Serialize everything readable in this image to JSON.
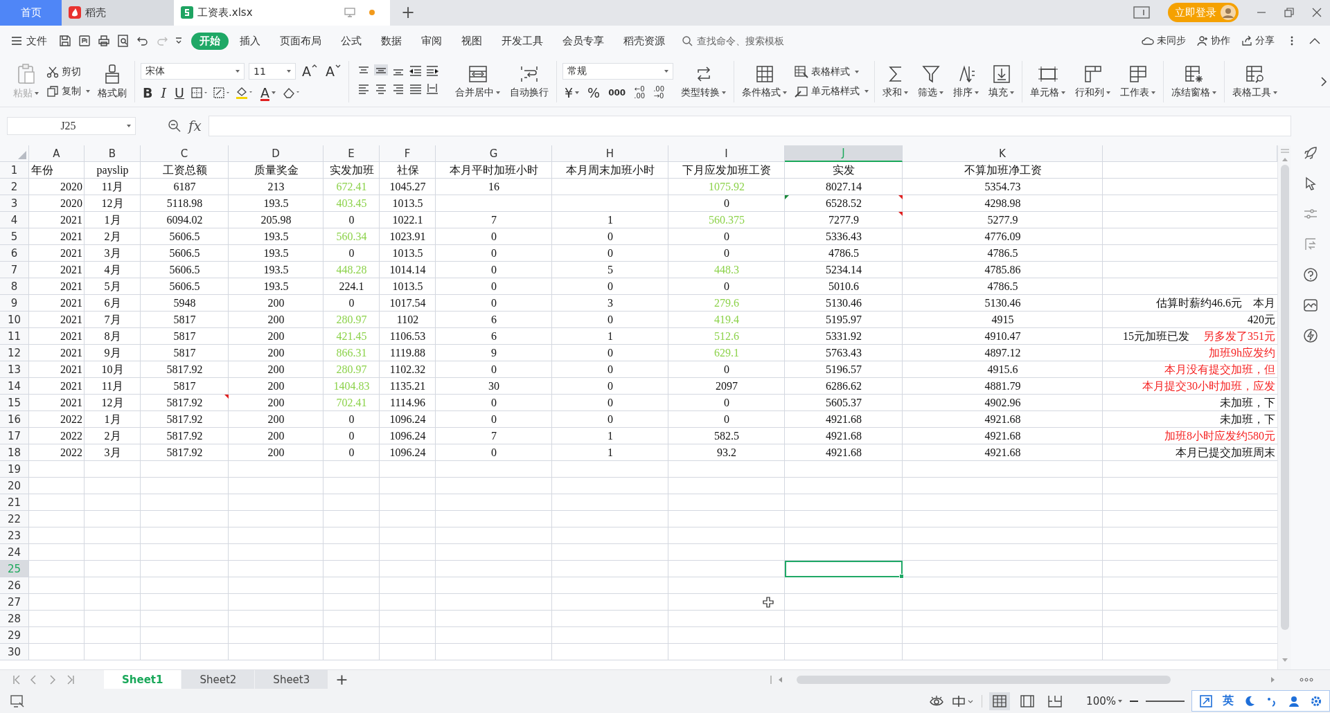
{
  "tabs": [
    {
      "kind": "home",
      "label": "首页",
      "selected": false
    },
    {
      "kind": "docer",
      "label": "稻壳",
      "selected": false
    },
    {
      "kind": "file",
      "label": "工资表.xlsx",
      "selected": true,
      "unsaved": true
    }
  ],
  "new_tab": "+",
  "login_button": "立即登录",
  "menu": {
    "file": "文件",
    "tabs": [
      {
        "label": "开始",
        "selected": true
      },
      {
        "label": "插入",
        "selected": false
      },
      {
        "label": "页面布局",
        "selected": false
      },
      {
        "label": "公式",
        "selected": false
      },
      {
        "label": "数据",
        "selected": false
      },
      {
        "label": "审阅",
        "selected": false
      },
      {
        "label": "视图",
        "selected": false
      },
      {
        "label": "开发工具",
        "selected": false
      },
      {
        "label": "会员专享",
        "selected": false
      },
      {
        "label": "稻壳资源",
        "selected": false
      }
    ],
    "search_placeholder": "查找命令、搜索模板",
    "sync": "未同步",
    "collab": "协作",
    "share": "分享"
  },
  "ribbon": {
    "paste": "粘贴",
    "paste_disabled": true,
    "cut": "剪切",
    "copy": "复制",
    "format_painter": "格式刷",
    "font": "宋体",
    "font_size": "11",
    "grow_font": "A",
    "shrink_font": "A",
    "bold": "B",
    "italic": "I",
    "underline": "U",
    "font_color": "A",
    "merge": "合并居中",
    "wrap": "自动换行",
    "number_format": "常规",
    "currency": "¥",
    "percent": "%",
    "thousands": "000",
    "decimal_increase": [
      "←0",
      ".00"
    ],
    "decimal_decrease": [
      ".00",
      "→0"
    ],
    "type_convert": "类型转换",
    "cond_format": "条件格式",
    "table_style": "表格样式",
    "cell_style": "单元格样式",
    "sum": "求和",
    "filter": "筛选",
    "sort": "排序",
    "fill": "填充",
    "cell": "单元格",
    "row_col": "行和列",
    "sheet": "工作表",
    "freeze": "冻结窗格",
    "table_tools": "表格工具"
  },
  "formula_bar": {
    "name_box": "J25",
    "fx": "fx"
  },
  "sheet": {
    "columns": [
      {
        "label": "A",
        "selected": false
      },
      {
        "label": "B",
        "selected": false
      },
      {
        "label": "C",
        "selected": false
      },
      {
        "label": "D",
        "selected": false
      },
      {
        "label": "E",
        "selected": false
      },
      {
        "label": "F",
        "selected": false
      },
      {
        "label": "G",
        "selected": false
      },
      {
        "label": "H",
        "selected": false
      },
      {
        "label": "I",
        "selected": false
      },
      {
        "label": "J",
        "selected": true
      },
      {
        "label": "K",
        "selected": false
      }
    ],
    "row_headers": [
      {
        "label": "1",
        "selected": false
      },
      {
        "label": "2",
        "selected": false
      },
      {
        "label": "3",
        "selected": false
      },
      {
        "label": "4",
        "selected": false
      },
      {
        "label": "5",
        "selected": false
      },
      {
        "label": "6",
        "selected": false
      },
      {
        "label": "7",
        "selected": false
      },
      {
        "label": "8",
        "selected": false
      },
      {
        "label": "9",
        "selected": false
      },
      {
        "label": "10",
        "selected": false
      },
      {
        "label": "11",
        "selected": false
      },
      {
        "label": "12",
        "selected": false
      },
      {
        "label": "13",
        "selected": false
      },
      {
        "label": "14",
        "selected": false
      },
      {
        "label": "15",
        "selected": false
      },
      {
        "label": "16",
        "selected": false
      },
      {
        "label": "17",
        "selected": false
      },
      {
        "label": "18",
        "selected": false
      },
      {
        "label": "19",
        "selected": false
      },
      {
        "label": "20",
        "selected": false
      },
      {
        "label": "21",
        "selected": false
      },
      {
        "label": "22",
        "selected": false
      },
      {
        "label": "23",
        "selected": false
      },
      {
        "label": "24",
        "selected": false
      },
      {
        "label": "25",
        "selected": true
      },
      {
        "label": "26",
        "selected": false
      },
      {
        "label": "27",
        "selected": false
      },
      {
        "label": "28",
        "selected": false
      },
      {
        "label": "29",
        "selected": false
      },
      {
        "label": "30",
        "selected": false
      }
    ],
    "rows": [
      {
        "cells": [
          "年份",
          "payslip",
          "工资总额",
          "质量奖金",
          "实发加班",
          "社保",
          "本月平时加班小时",
          "本月周末加班小时",
          "下月应发加班工资",
          "实发",
          "不算加班净工资"
        ],
        "e_green": false,
        "i_green": false,
        "c_comment": false,
        "j_error": false,
        "j_comment": false
      },
      {
        "cells": [
          "2020",
          "11月",
          "6187",
          "213",
          "672.41",
          "1045.27",
          "16",
          null,
          "1075.92",
          "8027.14",
          "5354.73"
        ],
        "e_green": true,
        "i_green": true,
        "c_comment": false,
        "j_error": false,
        "j_comment": false
      },
      {
        "cells": [
          "2020",
          "12月",
          "5118.98",
          "193.5",
          "403.45",
          "1013.5",
          null,
          null,
          "0",
          "6528.52",
          "4298.98"
        ],
        "e_green": true,
        "i_green": false,
        "c_comment": false,
        "j_error": true,
        "j_comment": true
      },
      {
        "cells": [
          "2021",
          "1月",
          "6094.02",
          "205.98",
          "0",
          "1022.1",
          "7",
          "1",
          "560.375",
          "7277.9",
          "5277.9"
        ],
        "e_green": false,
        "i_green": true,
        "c_comment": false,
        "j_error": false,
        "j_comment": true
      },
      {
        "cells": [
          "2021",
          "2月",
          "5606.5",
          "193.5",
          "560.34",
          "1023.91",
          "0",
          "0",
          "0",
          "5336.43",
          "4776.09"
        ],
        "e_green": true,
        "i_green": false,
        "c_comment": false,
        "j_error": false,
        "j_comment": false
      },
      {
        "cells": [
          "2021",
          "3月",
          "5606.5",
          "193.5",
          "0",
          "1013.5",
          "0",
          "0",
          "0",
          "4786.5",
          "4786.5"
        ],
        "e_green": false,
        "i_green": false,
        "c_comment": false,
        "j_error": false,
        "j_comment": false
      },
      {
        "cells": [
          "2021",
          "4月",
          "5606.5",
          "193.5",
          "448.28",
          "1014.14",
          "0",
          "5",
          "448.3",
          "5234.14",
          "4785.86"
        ],
        "e_green": true,
        "i_green": true,
        "c_comment": false,
        "j_error": false,
        "j_comment": false
      },
      {
        "cells": [
          "2021",
          "5月",
          "5606.5",
          "193.5",
          "224.1",
          "1013.5",
          "0",
          "0",
          "0",
          "5010.6",
          "4786.5"
        ],
        "e_green": false,
        "i_green": false,
        "c_comment": false,
        "j_error": false,
        "j_comment": false
      },
      {
        "cells": [
          "2021",
          "6月",
          "5948",
          "200",
          "0",
          "1017.54",
          "0",
          "3",
          "279.6",
          "5130.46",
          "5130.46"
        ],
        "e_green": false,
        "i_green": true,
        "c_comment": false,
        "j_error": false,
        "j_comment": false,
        "note": [
          {
            "text": "估算时薪约46.6元　本月",
            "kind": "plain"
          }
        ]
      },
      {
        "cells": [
          "2021",
          "7月",
          "5817",
          "200",
          "280.97",
          "1102",
          "6",
          "0",
          "419.4",
          "5195.97",
          "4915"
        ],
        "e_green": true,
        "i_green": true,
        "c_comment": false,
        "j_error": false,
        "j_comment": false,
        "note": [
          {
            "text": "420元",
            "kind": "plain"
          }
        ]
      },
      {
        "cells": [
          "2021",
          "8月",
          "5817",
          "200",
          "421.45",
          "1106.53",
          "6",
          "1",
          "512.6",
          "5331.92",
          "4910.47"
        ],
        "e_green": true,
        "i_green": true,
        "c_comment": false,
        "j_error": false,
        "j_comment": false,
        "note": [
          {
            "text": "15元加班已发",
            "kind": "plain"
          },
          {
            "text": "另多发了351元",
            "kind": "alert"
          }
        ]
      },
      {
        "cells": [
          "2021",
          "9月",
          "5817",
          "200",
          "866.31",
          "1119.88",
          "9",
          "0",
          "629.1",
          "5763.43",
          "4897.12"
        ],
        "e_green": true,
        "i_green": true,
        "c_comment": false,
        "j_error": false,
        "j_comment": false,
        "note": [
          {
            "text": "加班9h应发约",
            "kind": "alert"
          }
        ]
      },
      {
        "cells": [
          "2021",
          "10月",
          "5817.92",
          "200",
          "280.97",
          "1102.32",
          "0",
          "0",
          "0",
          "5196.57",
          "4915.6"
        ],
        "e_green": true,
        "i_green": false,
        "c_comment": false,
        "j_error": false,
        "j_comment": false,
        "note": [
          {
            "text": "本月没有提交加班，但",
            "kind": "alert"
          }
        ]
      },
      {
        "cells": [
          "2021",
          "11月",
          "5817",
          "200",
          "1404.83",
          "1135.21",
          "30",
          "0",
          "2097",
          "6286.62",
          "4881.79"
        ],
        "e_green": true,
        "i_green": false,
        "c_comment": false,
        "j_error": false,
        "j_comment": false,
        "note": [
          {
            "text": "本月提交30小时加班，应发",
            "kind": "alert"
          }
        ]
      },
      {
        "cells": [
          "2021",
          "12月",
          "5817.92",
          "200",
          "702.41",
          "1114.96",
          "0",
          "0",
          "0",
          "5605.37",
          "4902.96"
        ],
        "e_green": true,
        "i_green": false,
        "c_comment": true,
        "j_error": false,
        "j_comment": false,
        "note": [
          {
            "text": "未加班，下",
            "kind": "plain"
          }
        ]
      },
      {
        "cells": [
          "2022",
          "1月",
          "5817.92",
          "200",
          "0",
          "1096.24",
          "0",
          "0",
          "0",
          "4921.68",
          "4921.68"
        ],
        "e_green": false,
        "i_green": false,
        "c_comment": false,
        "j_error": false,
        "j_comment": false,
        "note": [
          {
            "text": "未加班，下",
            "kind": "plain"
          }
        ]
      },
      {
        "cells": [
          "2022",
          "2月",
          "5817.92",
          "200",
          "0",
          "1096.24",
          "7",
          "1",
          "582.5",
          "4921.68",
          "4921.68"
        ],
        "e_green": false,
        "i_green": false,
        "c_comment": false,
        "j_error": false,
        "j_comment": false,
        "note": [
          {
            "text": "加班8小时应发约580元",
            "kind": "alert"
          }
        ]
      },
      {
        "cells": [
          "2022",
          "3月",
          "5817.92",
          "200",
          "0",
          "1096.24",
          "0",
          "1",
          "93.2",
          "4921.68",
          "4921.68"
        ],
        "e_green": false,
        "i_green": false,
        "c_comment": false,
        "j_error": false,
        "j_comment": false,
        "note": [
          {
            "text": "本月已提交加班周末",
            "kind": "plain"
          }
        ]
      }
    ]
  },
  "sheet_tabs": [
    {
      "label": "Sheet1",
      "selected": true
    },
    {
      "label": "Sheet2",
      "selected": false
    },
    {
      "label": "Sheet3",
      "selected": false
    }
  ],
  "add_sheet": "+",
  "status_bar": {
    "zoom": "100%",
    "zoom_slider": {
      "level": 1
    },
    "ime_language": "英"
  }
}
